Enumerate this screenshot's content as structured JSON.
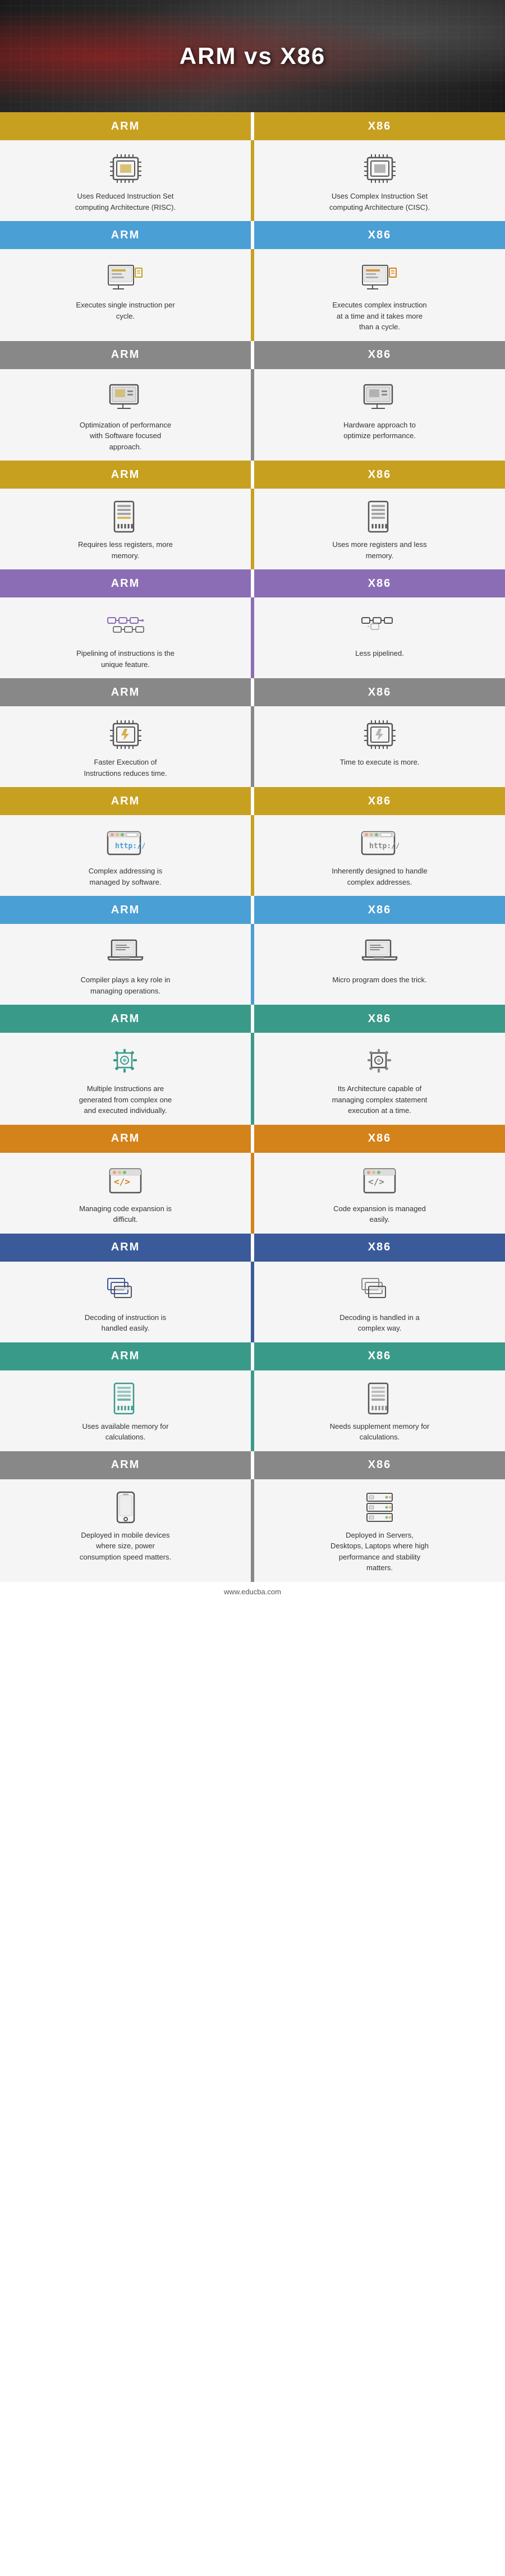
{
  "header": {
    "title": "ARM vs X86",
    "bg_desc": "circuit board background"
  },
  "columns": {
    "arm": "ARM",
    "x86": "X86"
  },
  "rows": [
    {
      "id": 1,
      "header_color": "gold",
      "arm_text": "Uses Reduced Instruction Set computing Architecture (RISC).",
      "x86_text": "Uses Complex Instruction Set computing Architecture (CISC).",
      "arm_icon": "chip",
      "x86_icon": "chip",
      "divider_color": "gold"
    },
    {
      "id": 2,
      "header_color": "blue",
      "arm_text": "Executes single instruction per cycle.",
      "x86_text": "Executes complex instruction at a time and it takes more than a cycle.",
      "arm_icon": "monitor-doc",
      "x86_icon": "monitor-doc-orange",
      "divider_color": "blue"
    },
    {
      "id": 3,
      "header_color": "gray",
      "arm_text": "Optimization of performance with Software focused approach.",
      "x86_text": "Hardware approach to optimize performance.",
      "arm_icon": "desktop",
      "x86_icon": "desktop",
      "divider_color": "gray"
    },
    {
      "id": 4,
      "header_color": "gold",
      "arm_text": "Requires less registers, more memory.",
      "x86_text": "Uses more registers and less memory.",
      "arm_icon": "memory",
      "x86_icon": "memory",
      "divider_color": "gold"
    },
    {
      "id": 5,
      "header_color": "purple",
      "arm_text": "Pipelining of instructions is the unique feature.",
      "x86_text": "Less pipelined.",
      "arm_icon": "pipeline",
      "x86_icon": "pipeline",
      "divider_color": "purple"
    },
    {
      "id": 6,
      "header_color": "gray",
      "arm_text": "Faster Execution of Instructions reduces time.",
      "x86_text": "Time to execute is more.",
      "arm_icon": "chip2",
      "x86_icon": "chip2",
      "divider_color": "gray"
    },
    {
      "id": 7,
      "header_color": "gold",
      "arm_text": "Complex addressing is managed by software.",
      "x86_text": "Inherently designed to handle complex addresses.",
      "arm_icon": "http",
      "x86_icon": "http",
      "divider_color": "gold"
    },
    {
      "id": 8,
      "header_color": "blue",
      "arm_text": "Compiler plays a key role in managing operations.",
      "x86_text": "Micro program does the trick.",
      "arm_icon": "laptop",
      "x86_icon": "laptop",
      "divider_color": "blue"
    },
    {
      "id": 9,
      "header_color": "teal",
      "arm_text": "Multiple Instructions are generated from complex one and executed individually.",
      "x86_text": "Its Architecture capable of managing complex statement execution at a time.",
      "arm_icon": "gear-chip",
      "x86_icon": "gear-chip",
      "divider_color": "teal"
    },
    {
      "id": 10,
      "header_color": "orange",
      "arm_text": "Managing code expansion is difficult.",
      "x86_text": "Code expansion is managed easily.",
      "arm_icon": "code-tag",
      "x86_icon": "code-tag",
      "divider_color": "orange"
    },
    {
      "id": 11,
      "header_color": "darkblue",
      "arm_text": "Decoding of instruction is handled easily.",
      "x86_text": "Decoding is handled in a complex way.",
      "arm_icon": "windows",
      "x86_icon": "windows",
      "divider_color": "darkblue"
    },
    {
      "id": 12,
      "header_color": "teal",
      "arm_text": "Uses available memory for calculations.",
      "x86_text": "Needs supplement memory for calculations.",
      "arm_icon": "memory2",
      "x86_icon": "memory2",
      "divider_color": "teal"
    },
    {
      "id": 13,
      "header_color": "gray",
      "arm_text": "Deployed in mobile devices where size, power consumption speed matters.",
      "x86_text": "Deployed in Servers, Desktops, Laptops where high performance and stability matters.",
      "arm_icon": "mobile",
      "x86_icon": "server",
      "divider_color": "gray"
    }
  ],
  "footer": {
    "url": "www.educba.com"
  }
}
